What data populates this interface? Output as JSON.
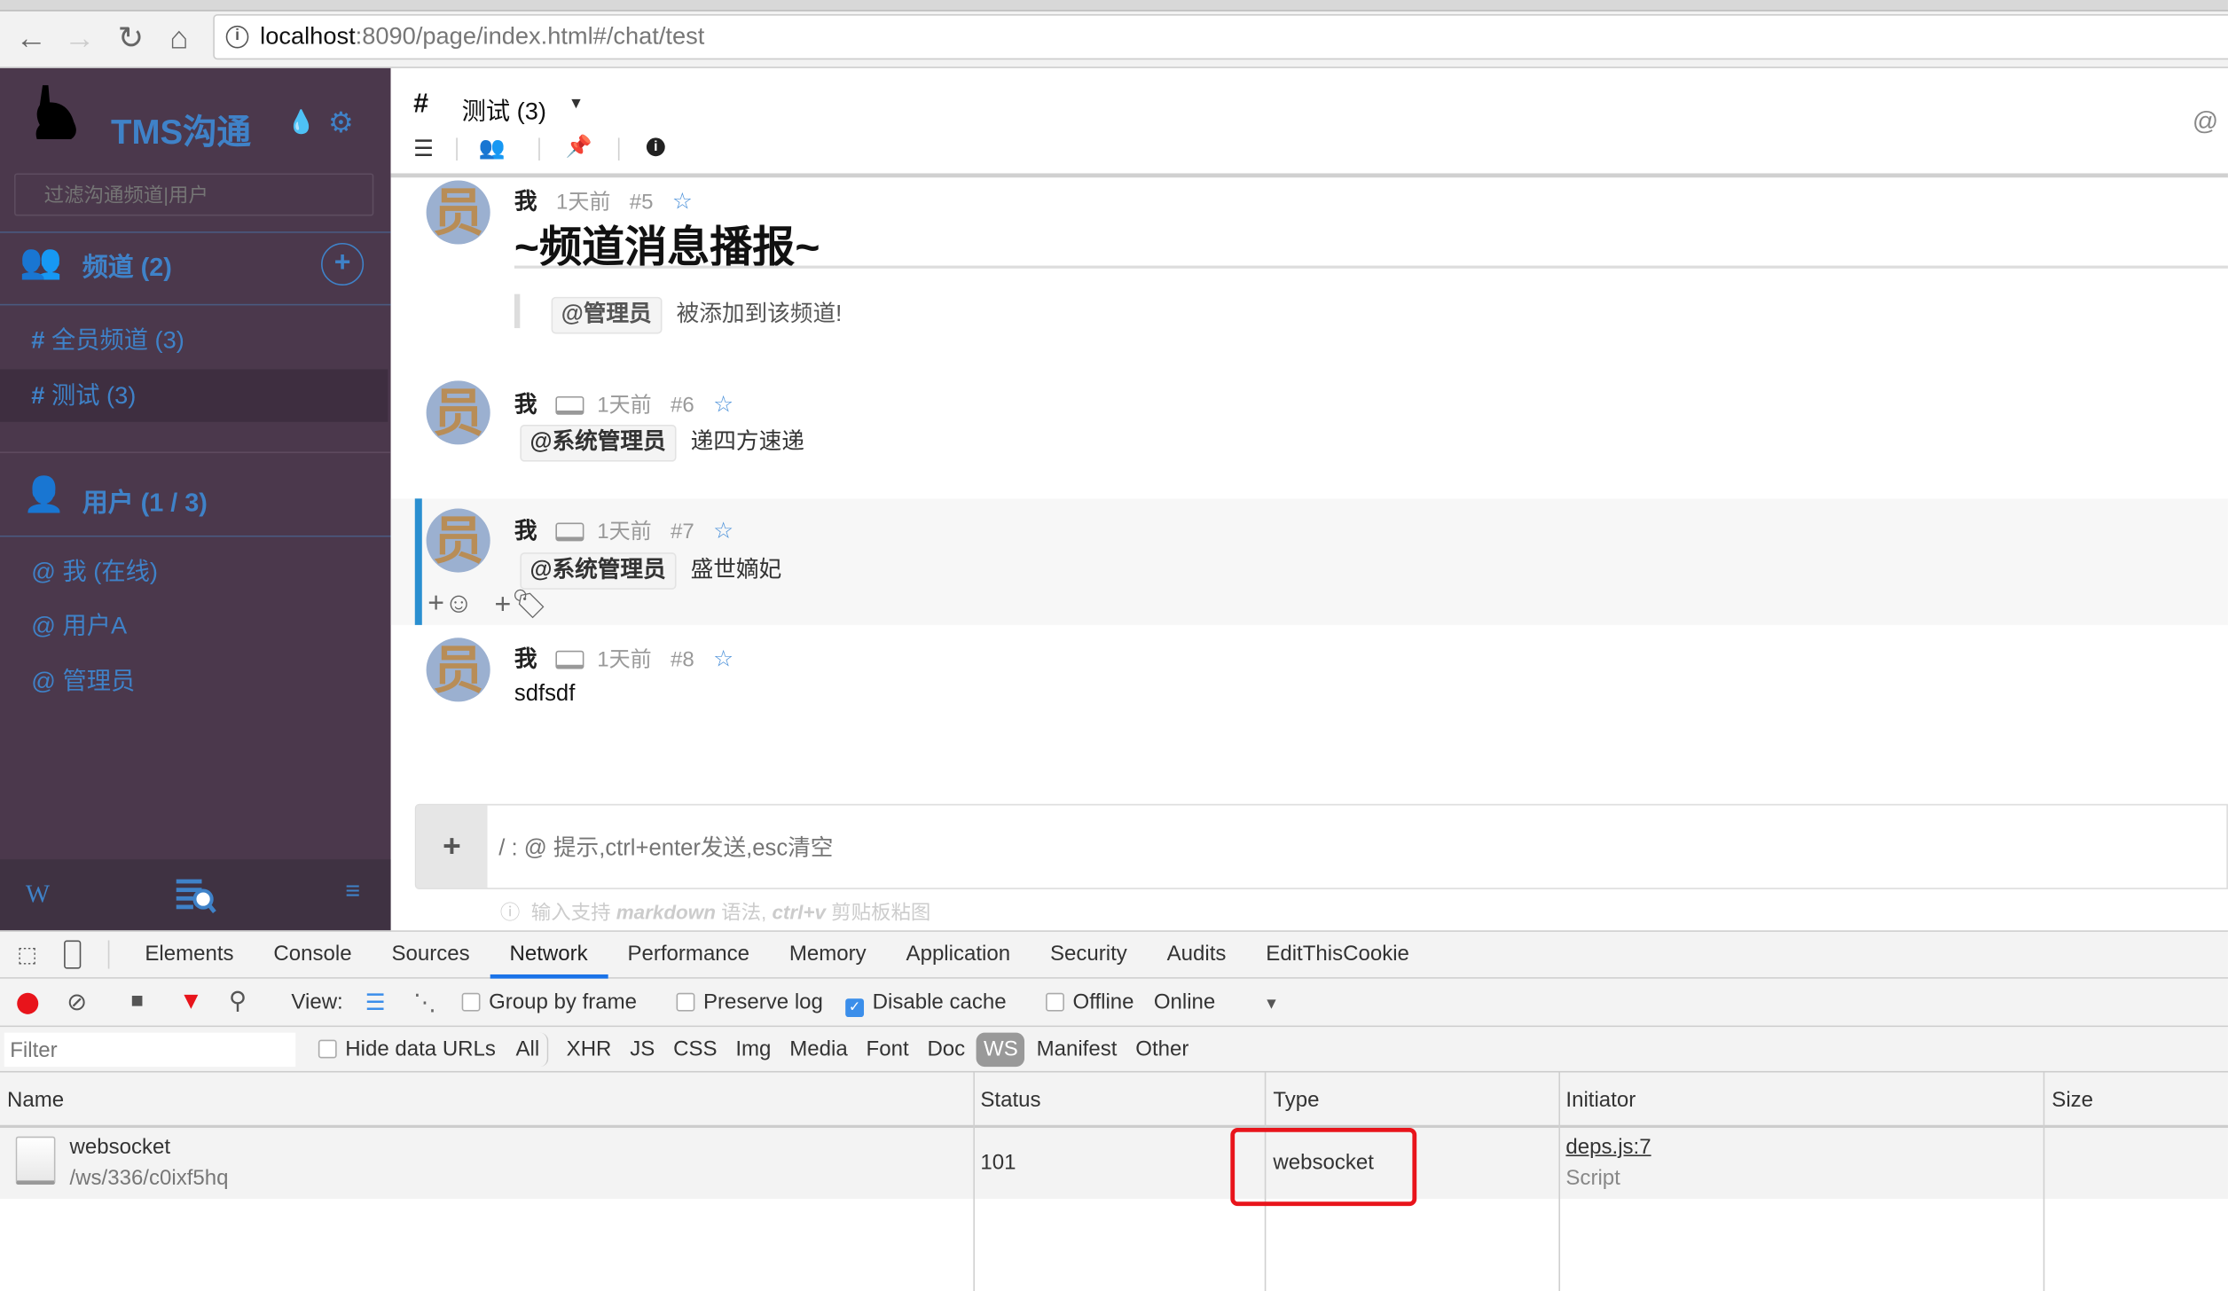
{
  "browser": {
    "url_host": "localhost",
    "url_path": ":8090/page/index.html#/chat/test",
    "back": "←",
    "forward": "→",
    "reload": "↻",
    "home": "⌂"
  },
  "sidebar": {
    "app_name": "TMS沟通",
    "filter_placeholder": "过滤沟通频道|用户",
    "channels_header": "频道 (2)",
    "channels": [
      {
        "label": "全员频道 (3)",
        "selected": false
      },
      {
        "label": "测试 (3)",
        "selected": true
      }
    ],
    "users_header": "用户 (1 / 3)",
    "users": [
      {
        "label": "我 (在线)"
      },
      {
        "label": "用户A"
      },
      {
        "label": "管理员"
      }
    ],
    "footer": {
      "wiki": "W"
    },
    "hash": "#",
    "at": "@"
  },
  "header": {
    "hash": "#",
    "title": "测试 (3)",
    "at": "@"
  },
  "messages": [
    {
      "author": "我",
      "time": "1天前",
      "id": "#5",
      "heading": "~频道消息播报~",
      "mention": "@管理员",
      "text": "被添加到该频道!"
    },
    {
      "author": "我",
      "time": "1天前",
      "id": "#6",
      "mention": "@系统管理员",
      "text": "递四方速递"
    },
    {
      "author": "我",
      "time": "1天前",
      "id": "#7",
      "mention": "@系统管理员",
      "text": "盛世嫡妃"
    },
    {
      "author": "我",
      "time": "1天前",
      "id": "#8",
      "text": "sdfsdf"
    }
  ],
  "avatar_char": "员",
  "composer": {
    "placeholder": "/ : @ 提示,ctrl+enter发送,esc清空",
    "plus": "+",
    "hint_pre": "输入支持 ",
    "hint_md": "markdown",
    "hint_mid": " 语法, ",
    "hint_key": "ctrl+v",
    "hint_post": " 剪贴板粘图"
  },
  "devtools": {
    "tabs": [
      "Elements",
      "Console",
      "Sources",
      "Network",
      "Performance",
      "Memory",
      "Application",
      "Security",
      "Audits",
      "EditThisCookie"
    ],
    "active_tab": "Network",
    "toolbar": {
      "view": "View:",
      "group_by_frame": "Group by frame",
      "preserve_log": "Preserve log",
      "disable_cache": "Disable cache",
      "offline": "Offline",
      "throttle": "Online"
    },
    "filter_placeholder": "Filter",
    "hide_data_urls": "Hide data URLs",
    "types": [
      "All",
      "XHR",
      "JS",
      "CSS",
      "Img",
      "Media",
      "Font",
      "Doc",
      "WS",
      "Manifest",
      "Other"
    ],
    "active_type": "WS",
    "columns": [
      "Name",
      "Status",
      "Type",
      "Initiator",
      "Size"
    ],
    "rows": [
      {
        "name": "websocket",
        "path": "/ws/336/c0ixf5hq",
        "status": "101",
        "type": "websocket",
        "initiator": "deps.js:7",
        "initiator_type": "Script",
        "size": ""
      }
    ],
    "highlight_color": "#e8141b"
  },
  "colors": {
    "sidebar": "#4b384c",
    "accent": "#3f82c8",
    "active_tab": "#1a73e8"
  }
}
